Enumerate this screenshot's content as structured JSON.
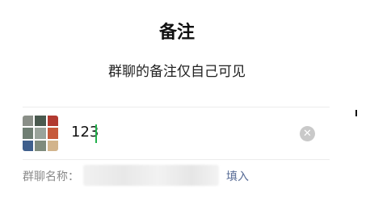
{
  "header": {
    "title": "备注",
    "subtitle": "群聊的备注仅自己可见"
  },
  "remark_field": {
    "value": "123",
    "avatar_icon": "group-avatar-icon",
    "clear_icon": "clear-icon",
    "clear_symbol": "✕",
    "avatar_colors": [
      "#8a8f88",
      "#4a5a4f",
      "#b23a30",
      "#6f7e73",
      "#9aa39b",
      "#c65a3b",
      "#3f5f8c",
      "#7f8b7d",
      "#d2b48c"
    ]
  },
  "group_name": {
    "label": "群聊名称：",
    "action": "填入"
  }
}
